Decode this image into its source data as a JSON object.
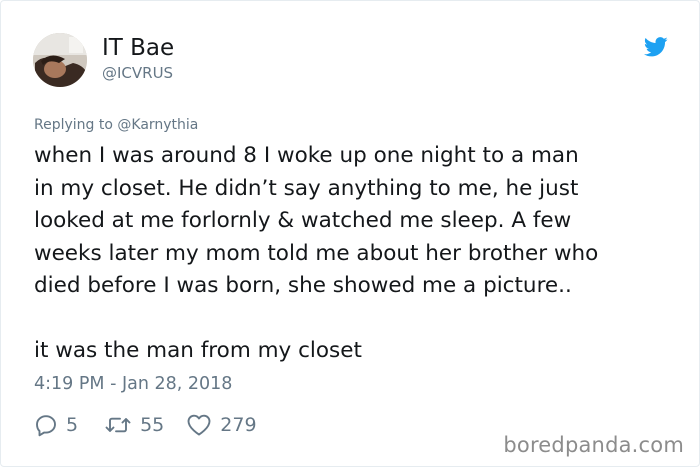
{
  "author": {
    "display_name": "IT Bae",
    "handle": "@ICVRUS"
  },
  "reply_context": "Replying to @Karnythia",
  "tweet": {
    "paragraph1_lines": [
      "when I was around 8 I woke up one night to a man",
      "in my closet. He didn’t say anything to me, he just",
      "looked at me forlornly & watched me sleep. A few",
      "weeks later my mom told me about her brother who",
      "died before I was born, she showed me a picture.."
    ],
    "paragraph2": "it was the man from my closet",
    "timestamp": "4:19 PM - Jan 28, 2018"
  },
  "actions": {
    "replies": "5",
    "retweets": "55",
    "likes": "279"
  },
  "icons": {
    "brand": "twitter-bird-icon",
    "reply": "reply-icon",
    "retweet": "retweet-icon",
    "like": "heart-icon"
  },
  "colors": {
    "text": "#14171a",
    "secondary": "#657786",
    "brand": "#1da1f2",
    "border": "#e6ecf0"
  },
  "watermark": "boredpanda.com"
}
